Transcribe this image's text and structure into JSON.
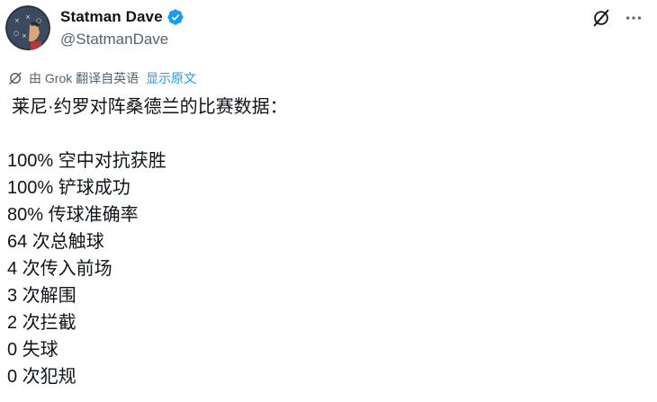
{
  "author": {
    "display_name": "Statman Dave",
    "handle": "@StatmanDave",
    "verified": true
  },
  "icons": {
    "verified": "verified-badge-icon",
    "grok": "grok-icon",
    "more": "more-dots-icon",
    "grok_action": "grok-slash-icon"
  },
  "translation": {
    "label": "由 Grok 翻译自英语",
    "show_original": "显示原文"
  },
  "tweet": {
    "intro": "莱尼·约罗对阵桑德兰的比赛数据：",
    "stats": [
      "100% 空中对抗获胜",
      "100% 铲球成功",
      "80% 传球准确率",
      "64 次总触球",
      "4 次传入前场",
      "3 次解围",
      "2 次拦截",
      "0 失球",
      "0 次犯规"
    ]
  },
  "colors": {
    "text": "#0f1419",
    "secondary": "#536471",
    "link": "#1d9bf0",
    "verified": "#1d9bf0"
  }
}
